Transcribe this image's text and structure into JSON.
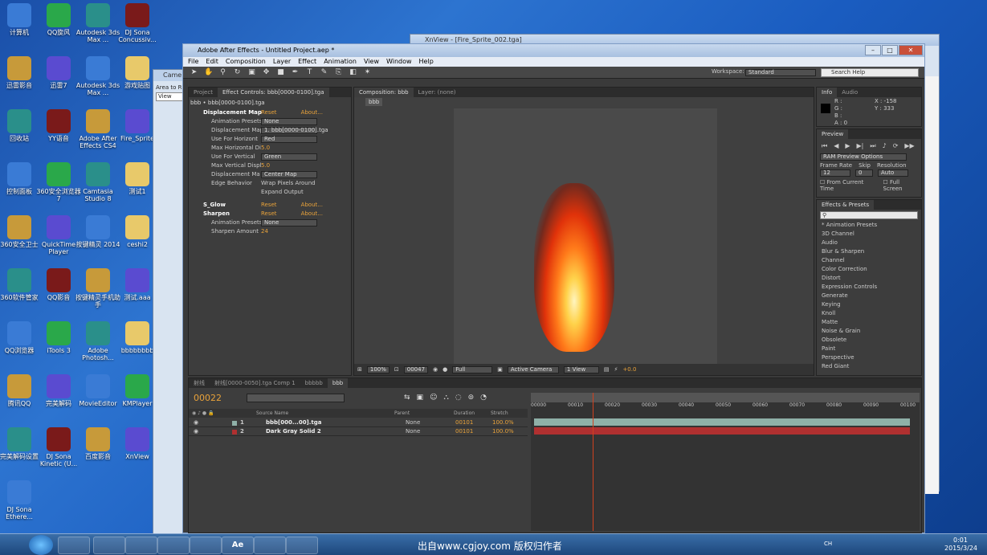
{
  "desktop": {
    "icons": [
      {
        "label": "计算机",
        "icon": "computer-icon"
      },
      {
        "label": "QQ旋风",
        "icon": "qq-whirlwind-icon"
      },
      {
        "label": "Autodesk 3ds Max ...",
        "icon": "3dsmax-icon"
      },
      {
        "label": "DJ Sona Concussiv...",
        "icon": "video-thumb-icon"
      },
      {
        "label": "迅雷影音",
        "icon": "xunlei-player-icon"
      },
      {
        "label": "迅雷7",
        "icon": "xunlei-icon"
      },
      {
        "label": "Autodesk 3ds Max ...",
        "icon": "3dsmax-icon"
      },
      {
        "label": "游戏贴图",
        "icon": "folder-icon"
      },
      {
        "label": "回收站",
        "icon": "recycle-bin-icon"
      },
      {
        "label": "YY语音",
        "icon": "yy-icon"
      },
      {
        "label": "Adobe After Effects CS4",
        "icon": "after-effects-icon"
      },
      {
        "label": "Fire_Sprite",
        "icon": "image-thumb-icon"
      },
      {
        "label": "控制面板",
        "icon": "control-panel-icon"
      },
      {
        "label": "360安全浏览器7",
        "icon": "360-browser-icon"
      },
      {
        "label": "Camtasia Studio 8",
        "icon": "camtasia-icon"
      },
      {
        "label": "测试1",
        "icon": "folder-icon"
      },
      {
        "label": "360安全卫士",
        "icon": "360-safe-icon"
      },
      {
        "label": "QuickTime Player",
        "icon": "quicktime-icon"
      },
      {
        "label": "按键精灵 2014",
        "icon": "anjian-icon"
      },
      {
        "label": "ceshi2",
        "icon": "folder-icon"
      },
      {
        "label": "360软件管家",
        "icon": "360-soft-icon"
      },
      {
        "label": "QQ影音",
        "icon": "qq-player-icon"
      },
      {
        "label": "按键精灵手机助手",
        "icon": "anjian-mobile-icon"
      },
      {
        "label": "测试.aaa",
        "icon": "file-icon"
      },
      {
        "label": "QQ浏览器",
        "icon": "qq-browser-icon"
      },
      {
        "label": "iTools 3",
        "icon": "itools-icon"
      },
      {
        "label": "Adobe Photosh...",
        "icon": "photoshop-icon"
      },
      {
        "label": "bbbbbbbb",
        "icon": "folder-icon"
      },
      {
        "label": "腾讯QQ",
        "icon": "qq-icon"
      },
      {
        "label": "完美解码",
        "icon": "perfect-decoder-icon"
      },
      {
        "label": "MovieEditor",
        "icon": "movie-editor-icon"
      },
      {
        "label": "KMPlayer",
        "icon": "kmplayer-icon"
      },
      {
        "label": "完美解码设置",
        "icon": "decoder-settings-icon"
      },
      {
        "label": "DJ Sona Kinetic (U...",
        "icon": "video-thumb-icon"
      },
      {
        "label": "百度影音",
        "icon": "baidu-player-icon"
      },
      {
        "label": "XnView",
        "icon": "xnview-icon"
      },
      {
        "label": "DJ Sona Ethere...",
        "icon": "video-thumb-icon"
      }
    ]
  },
  "bg_windows": {
    "xnview_title": "XnView - [Fire_Sprite_002.tga]",
    "camera_title": "Came",
    "camera_area_label": "Area to R",
    "camera_view": "View"
  },
  "ae": {
    "title": "Adobe After Effects - Untitled Project.aep *",
    "menu": [
      "File",
      "Edit",
      "Composition",
      "Layer",
      "Effect",
      "Animation",
      "View",
      "Window",
      "Help"
    ],
    "workspace_label": "Workspace:",
    "workspace_value": "Standard",
    "search_help": "Search Help",
    "effect_controls": {
      "tabs": [
        "Project",
        "Effect Controls: bbb[0000-0100].tga"
      ],
      "layer_path": "bbb • bbb[0000-0100].tga",
      "rows": [
        {
          "label": "Displacement Map",
          "reset": "Reset",
          "about": "About..."
        },
        {
          "label": "Animation Presets:",
          "value": "None"
        },
        {
          "label": "Displacement Map La",
          "value": "1. bbb[0000-0100].tga"
        },
        {
          "label": "Use For Horizont",
          "value": "Red"
        },
        {
          "label": "Max Horizontal Di",
          "value": "5.0"
        },
        {
          "label": "Use For Vertical",
          "value": "Green"
        },
        {
          "label": "Max Vertical Displ",
          "value": "5.0"
        },
        {
          "label": "Displacement Ma",
          "value": "Center Map"
        },
        {
          "label": "Edge Behavior",
          "value": "Wrap Pixels Around"
        },
        {
          "label": "",
          "value": "Expand Output"
        },
        {
          "label": "S_Glow",
          "reset": "Reset",
          "about": "About..."
        },
        {
          "label": "Sharpen",
          "reset": "Reset",
          "about": "About..."
        },
        {
          "label": "Animation Presets:",
          "value": "None"
        },
        {
          "label": "Sharpen Amount",
          "value": "24"
        }
      ]
    },
    "comp": {
      "tab": "Composition: bbb",
      "layer_tab": "Layer: (none)",
      "crumb": "bbb",
      "zoom": "100%",
      "timecode": "00047",
      "resolution": "Full",
      "camera": "Active Camera",
      "views": "1 View",
      "exposure": "+0.0"
    },
    "info": {
      "tabs": [
        "Info",
        "Audio"
      ],
      "r": "R :",
      "g": "G :",
      "b": "B :",
      "a": "A : 0",
      "x": "X : -158",
      "y": "Y : 333"
    },
    "preview": {
      "tab": "Preview",
      "ram": "RAM Preview Options",
      "frame_rate_label": "Frame Rate",
      "skip_label": "Skip",
      "resolution_label": "Resolution",
      "frame_rate": "12",
      "skip": "0",
      "resolution": "Auto",
      "from_current": "From Current Time",
      "full_screen": "Full Screen"
    },
    "effects_presets": {
      "tab": "Effects & Presets",
      "items": [
        "* Animation Presets",
        "3D Channel",
        "Audio",
        "Blur & Sharpen",
        "Channel",
        "Color Correction",
        "Distort",
        "Expression Controls",
        "Generate",
        "Keying",
        "Knoll",
        "Matte",
        "Noise & Grain",
        "Obsolete",
        "Paint",
        "Perspective",
        "Red Giant"
      ]
    },
    "timeline": {
      "tabs": [
        "射线",
        "射线[0000-0050].tga Comp 1",
        "bbbbb",
        "bbb"
      ],
      "timecode": "00022",
      "col_source": "Source Name",
      "col_parent": "Parent",
      "col_duration": "Duration",
      "col_stretch": "Stretch",
      "ruler": [
        "00000",
        "00010",
        "00020",
        "00030",
        "00040",
        "00050",
        "00060",
        "00070",
        "00080",
        "00090",
        "00100"
      ],
      "layers": [
        {
          "num": "1",
          "name": "bbb[000...00].tga",
          "parent": "None",
          "duration": "00101",
          "stretch": "100.0%",
          "color": "#8fb0a8"
        },
        {
          "num": "2",
          "name": "Dark Gray Solid 2",
          "parent": "None",
          "duration": "00101",
          "stretch": "100.0%",
          "color": "#b03030"
        }
      ]
    }
  },
  "watermark": "出自www.cgjoy.com 版权归作者",
  "tray": {
    "lang": "CH",
    "time": "0:01",
    "date": "2015/3/24"
  }
}
